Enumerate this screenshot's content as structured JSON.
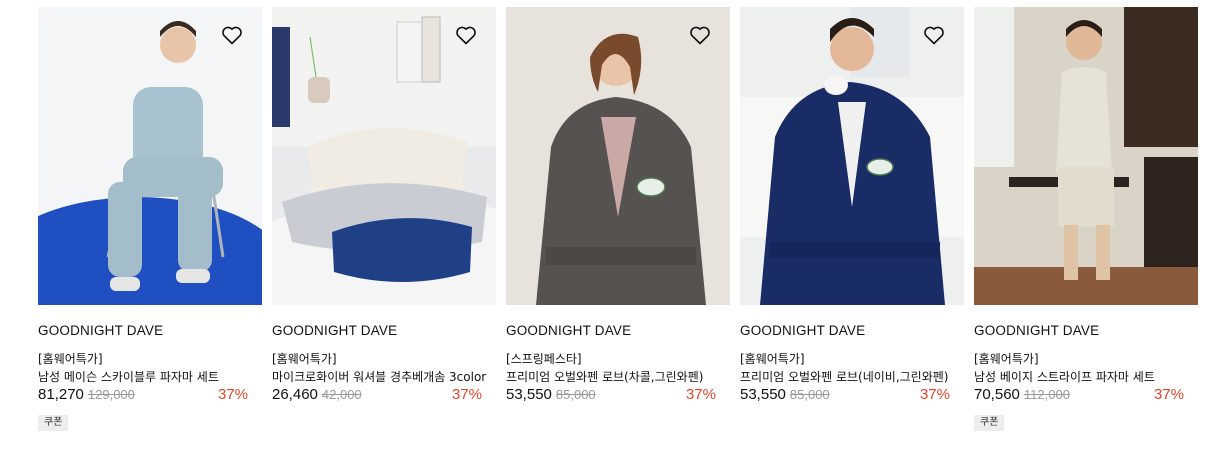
{
  "products": [
    {
      "brand": "GOODNIGHT DAVE",
      "tag": "[홈웨어특가]",
      "title": "남성 메이슨 스카이블루 파자마 세트",
      "price": "81,270",
      "original_price": "129,000",
      "discount": "37%",
      "badge": "쿠폰",
      "wish_icon": "heart-outline-icon"
    },
    {
      "brand": "GOODNIGHT DAVE",
      "tag": "[홈웨어특가]",
      "title": "마이크로화이버 워셔블 경추베개솜 3color",
      "price": "26,460",
      "original_price": "42,000",
      "discount": "37%",
      "badge": "",
      "wish_icon": "heart-outline-icon"
    },
    {
      "brand": "GOODNIGHT DAVE",
      "tag": "[스프링페스타]",
      "title": "프리미엄 오벌와펜 로브(차콜,그린와펜)",
      "price": "53,550",
      "original_price": "85,000",
      "discount": "37%",
      "badge": "",
      "wish_icon": "heart-outline-icon"
    },
    {
      "brand": "GOODNIGHT DAVE",
      "tag": "[홈웨어특가]",
      "title": "프리미엄 오벌와펜 로브(네이비,그린와펜)",
      "price": "53,550",
      "original_price": "85,000",
      "discount": "37%",
      "badge": "",
      "wish_icon": "heart-outline-icon"
    },
    {
      "brand": "GOODNIGHT DAVE",
      "tag": "[홈웨어특가]",
      "title": "남성 베이지 스트라이프 파자마 세트",
      "price": "70,560",
      "original_price": "112,000",
      "discount": "37%",
      "badge": "쿠폰",
      "wish_icon": ""
    }
  ],
  "colors": {
    "discount": "#e2462b",
    "original_price": "#9a9a9a",
    "badge_bg": "#ededed"
  }
}
